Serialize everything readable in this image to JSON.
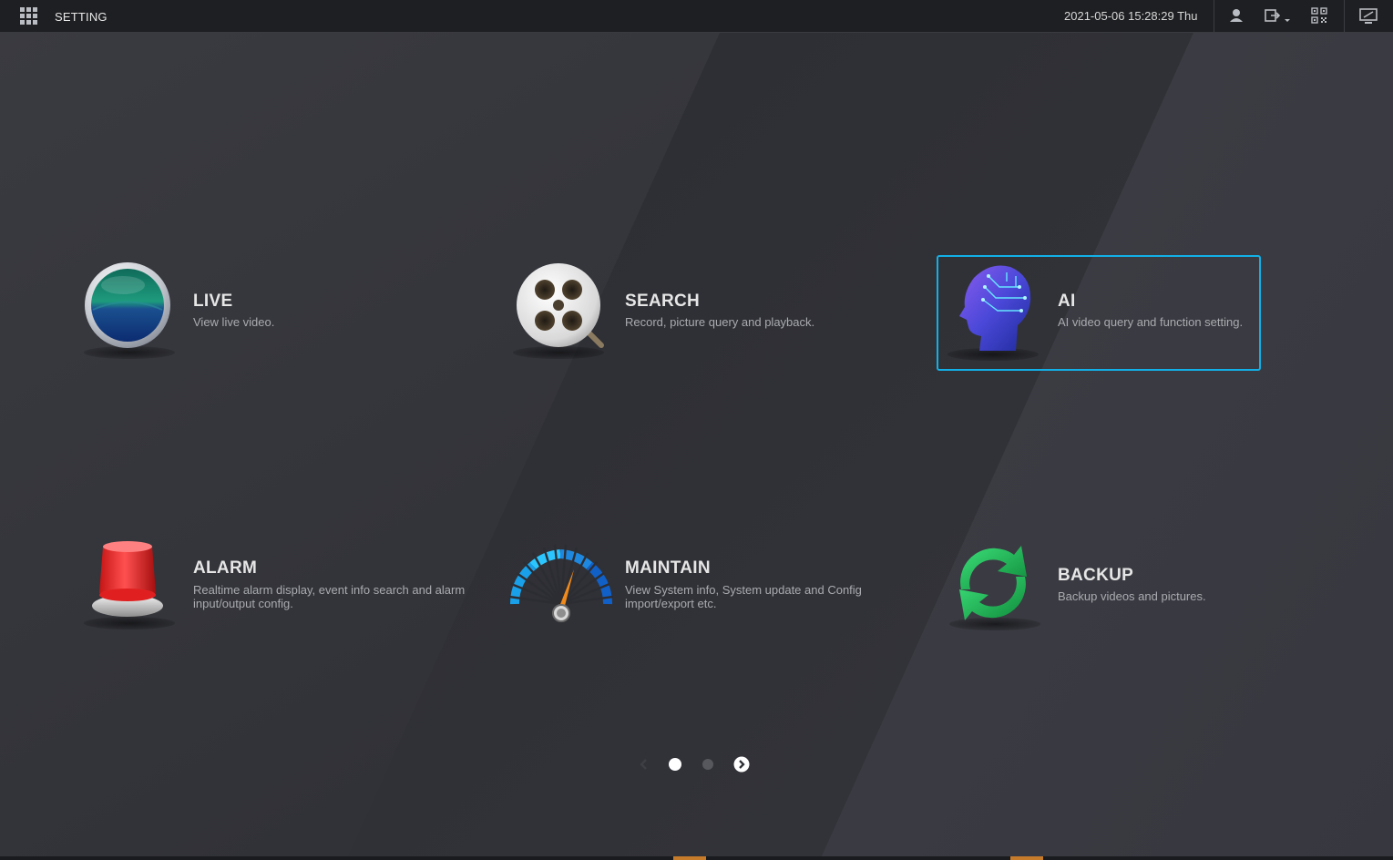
{
  "header": {
    "title": "SETTING",
    "datetime": "2021-05-06 15:28:29 Thu",
    "icons": [
      "apps-grid-icon",
      "user-icon",
      "logout-icon",
      "qr-code-icon",
      "display-icon"
    ]
  },
  "tiles": [
    {
      "key": "live",
      "name": "LIVE",
      "desc": "View live video.",
      "icon": "live-globe-icon"
    },
    {
      "key": "search",
      "name": "SEARCH",
      "desc": "Record, picture query and playback.",
      "icon": "film-reel-icon"
    },
    {
      "key": "ai",
      "name": "AI",
      "desc": "AI video query and function setting.",
      "icon": "ai-head-icon",
      "selected": true
    },
    {
      "key": "alarm",
      "name": "ALARM",
      "desc_line1": "Realtime alarm display, event info search and alarm",
      "desc_line2": "input/output config.",
      "icon": "alarm-siren-icon"
    },
    {
      "key": "maintain",
      "name": "MAINTAIN",
      "desc_line1": "View System info, System update and Config",
      "desc_line2": "import/export etc.",
      "icon": "speedometer-icon"
    },
    {
      "key": "backup",
      "name": "BACKUP",
      "desc": "Backup videos and pictures.",
      "icon": "refresh-arrows-icon"
    }
  ],
  "pagination": {
    "current_page": 1,
    "total_pages": 2
  },
  "colors": {
    "selection": "#12b0e8",
    "accent_bottom": "#c67b2b",
    "background": "#2f3036"
  }
}
